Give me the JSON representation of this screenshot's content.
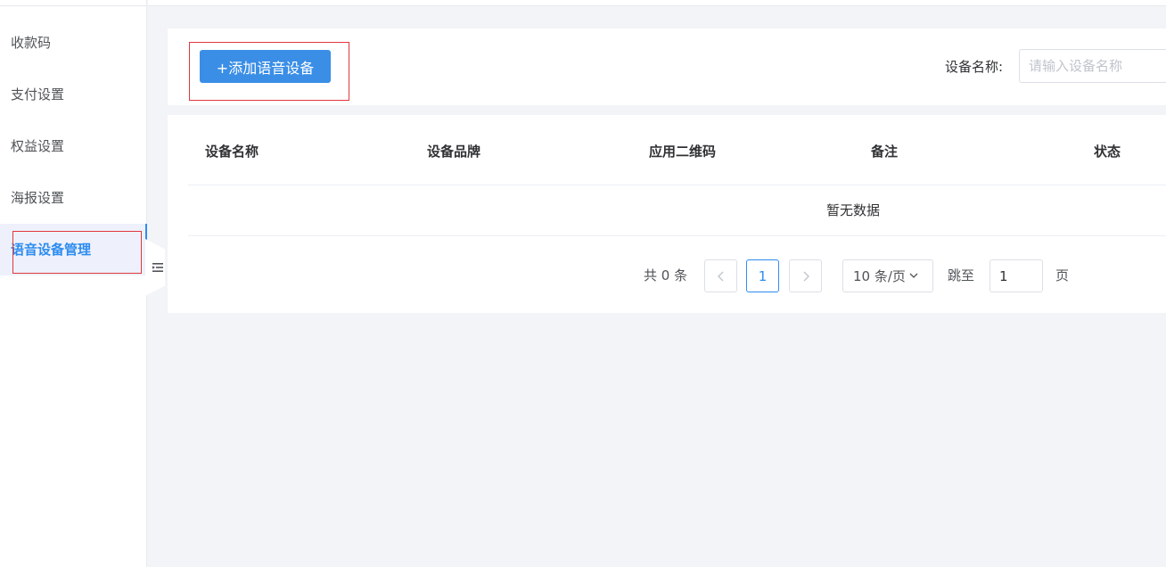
{
  "sidebar": {
    "items": [
      {
        "label": "收款码"
      },
      {
        "label": "支付设置"
      },
      {
        "label": "权益设置"
      },
      {
        "label": "海报设置"
      },
      {
        "label": "语音设备管理",
        "active": true
      }
    ]
  },
  "toolbar": {
    "add_label": "+添加语音设备",
    "search_label": "设备名称:",
    "search_placeholder": "请输入设备名称"
  },
  "table": {
    "columns": [
      "设备名称",
      "设备品牌",
      "应用二维码",
      "备注",
      "状态"
    ],
    "empty_text": "暂无数据"
  },
  "pagination": {
    "total_text": "共 0 条",
    "current_page": "1",
    "page_size": "10 条/页",
    "jump_label": "跳至",
    "jump_value": "1",
    "page_label": "页"
  },
  "colors": {
    "accent": "#2d8cf0",
    "button": "#3a8ee6",
    "highlight": "#e0383e"
  }
}
